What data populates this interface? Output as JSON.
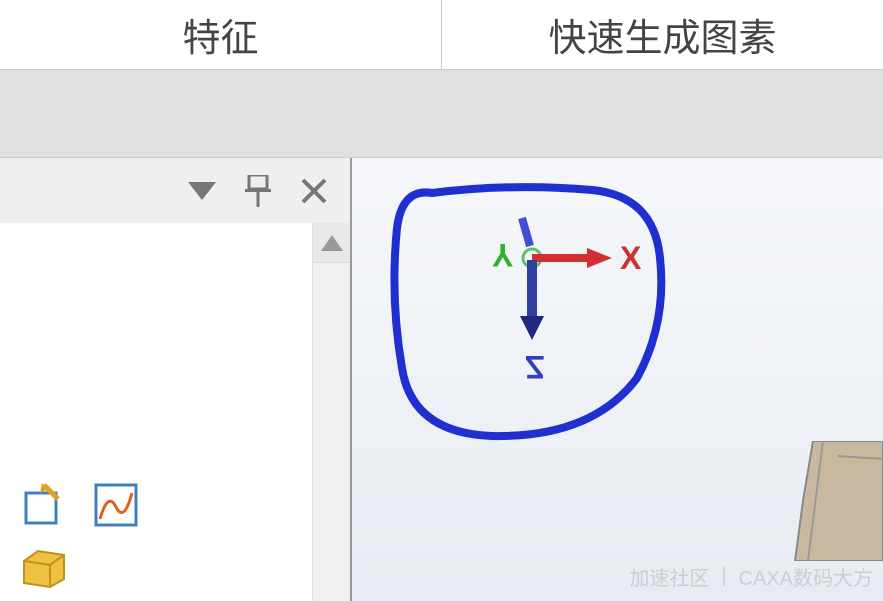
{
  "tabs": {
    "features": "特征",
    "quickGenerate": "快速生成图素"
  },
  "axes": {
    "x": "X",
    "y": "Y",
    "z": "Z"
  },
  "watermark": {
    "left": "加速社区",
    "sep": "|",
    "right": "CAXA数码大方"
  }
}
